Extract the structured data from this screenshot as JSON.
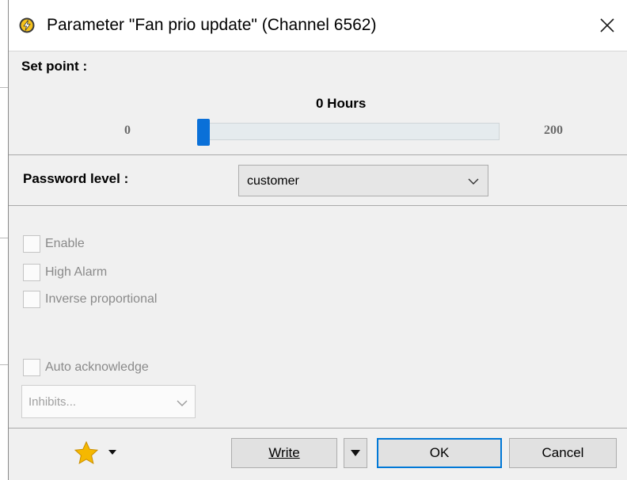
{
  "dialog": {
    "title": "Parameter \"Fan prio update\" (Channel 6562)"
  },
  "setpoint": {
    "label": "Set point :",
    "value_text": "0 Hours",
    "min": "0",
    "max": "200",
    "level": 0
  },
  "password": {
    "label": "Password level :",
    "selected": "customer"
  },
  "options": {
    "enable": "Enable",
    "high_alarm": "High Alarm",
    "inverse_proportional": "Inverse proportional",
    "auto_acknowledge": "Auto acknowledge"
  },
  "inhibits": {
    "selected": "Inhibits..."
  },
  "footer": {
    "write_label": "Write",
    "ok_label": "OK",
    "cancel_label": "Cancel"
  },
  "colors": {
    "accent": "#0a70d8",
    "focus_border": "#0078d7",
    "star": "#f5b800"
  }
}
